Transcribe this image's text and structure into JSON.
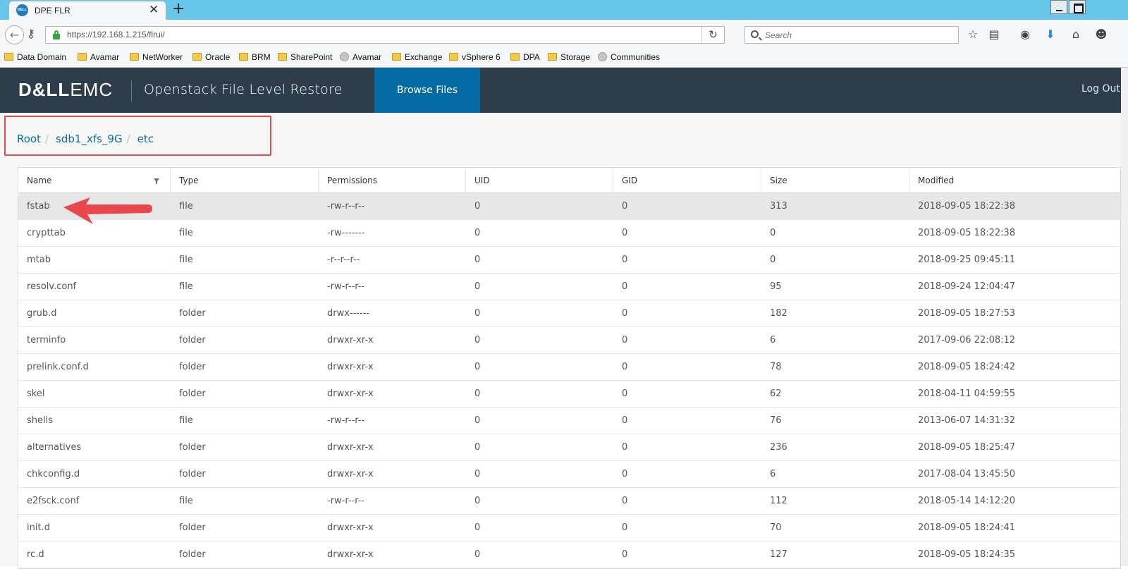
{
  "browser": {
    "tab_title": "DPE FLR",
    "favicon_text": "DELL",
    "new_tab_symbol": "+",
    "close_symbol": "✕",
    "url": "https://192.168.1.215/flrui/",
    "search_placeholder": "Search",
    "bookmarks": [
      {
        "label": "Data Domain",
        "icon": "folder-icon"
      },
      {
        "label": "Avamar",
        "icon": "folder-icon"
      },
      {
        "label": "NetWorker",
        "icon": "folder-icon"
      },
      {
        "label": "Oracle",
        "icon": "folder-icon"
      },
      {
        "label": "BRM",
        "icon": "folder-icon"
      },
      {
        "label": "SharePoint",
        "icon": "folder-icon"
      },
      {
        "label": "Avamar",
        "icon": "globe-icon"
      },
      {
        "label": "Exchange",
        "icon": "folder-icon"
      },
      {
        "label": "vSphere 6",
        "icon": "folder-icon"
      },
      {
        "label": "DPA",
        "icon": "folder-icon"
      },
      {
        "label": "Storage",
        "icon": "folder-icon"
      },
      {
        "label": "Communities",
        "icon": "globe-icon"
      }
    ]
  },
  "app": {
    "logo_dell": "D&LL",
    "logo_emc": "EMC",
    "title": "Openstack File Level Restore",
    "nav_browse": "Browse Files",
    "logout": "Log Out",
    "header_color": "#2e3d4b",
    "accent_color": "#036aa3"
  },
  "breadcrumb": [
    "Root",
    "sdb1_xfs_9G",
    "etc"
  ],
  "table": {
    "columns": [
      "Name",
      "Type",
      "Permissions",
      "UID",
      "GID",
      "Size",
      "Modified"
    ],
    "rows": [
      [
        "fstab",
        "file",
        "-rw-r--r--",
        "0",
        "0",
        "313",
        "2018-09-05 18:22:38"
      ],
      [
        "crypttab",
        "file",
        "-rw-------",
        "0",
        "0",
        "0",
        "2018-09-05 18:22:38"
      ],
      [
        "mtab",
        "file",
        "-r--r--r--",
        "0",
        "0",
        "0",
        "2018-09-25 09:45:11"
      ],
      [
        "resolv.conf",
        "file",
        "-rw-r--r--",
        "0",
        "0",
        "95",
        "2018-09-24 12:04:47"
      ],
      [
        "grub.d",
        "folder",
        "drwx------",
        "0",
        "0",
        "182",
        "2018-09-05 18:27:53"
      ],
      [
        "terminfo",
        "folder",
        "drwxr-xr-x",
        "0",
        "0",
        "6",
        "2017-09-06 22:08:12"
      ],
      [
        "prelink.conf.d",
        "folder",
        "drwxr-xr-x",
        "0",
        "0",
        "78",
        "2018-09-05 18:24:42"
      ],
      [
        "skel",
        "folder",
        "drwxr-xr-x",
        "0",
        "0",
        "62",
        "2018-04-11 04:59:55"
      ],
      [
        "shells",
        "file",
        "-rw-r--r--",
        "0",
        "0",
        "76",
        "2013-06-07 14:31:32"
      ],
      [
        "alternatives",
        "folder",
        "drwxr-xr-x",
        "0",
        "0",
        "236",
        "2018-09-05 18:25:47"
      ],
      [
        "chkconfig.d",
        "folder",
        "drwxr-xr-x",
        "0",
        "0",
        "6",
        "2017-08-04 13:45:50"
      ],
      [
        "e2fsck.conf",
        "file",
        "-rw-r--r--",
        "0",
        "0",
        "112",
        "2018-05-14 14:12:20"
      ],
      [
        "init.d",
        "folder",
        "drwxr-xr-x",
        "0",
        "0",
        "70",
        "2018-09-05 18:24:41"
      ],
      [
        "rc.d",
        "folder",
        "drwxr-xr-x",
        "0",
        "0",
        "127",
        "2018-09-05 18:24:35"
      ]
    ],
    "selected_row": 0
  },
  "annotation": {
    "arrow_color": "#e8474d",
    "highlight_color": "#e8474d"
  }
}
